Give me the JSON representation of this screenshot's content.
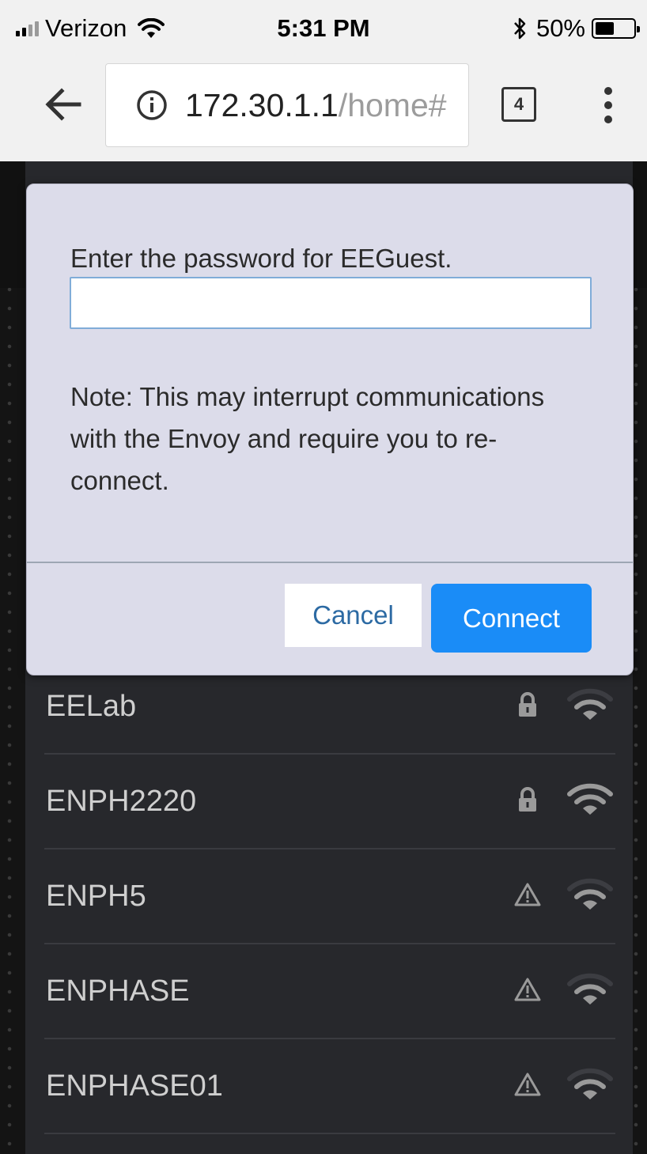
{
  "status_bar": {
    "carrier": "Verizon",
    "time": "5:31 PM",
    "battery": "50%",
    "battery_level": 0.5,
    "icons": [
      "signal-icon",
      "wifi-icon",
      "bluetooth-icon",
      "battery-icon"
    ]
  },
  "browser": {
    "url_host": "172.30.1.1",
    "url_path": "/home#",
    "tab_count": "4",
    "icons": [
      "back-arrow-icon",
      "info-icon",
      "tabs-icon",
      "more-vert-icon"
    ]
  },
  "dialog": {
    "prompt": "Enter the password for EEGuest.",
    "password_value": "",
    "note": "Note: This may interrupt communications with the Envoy and require you to re-connect.",
    "cancel_label": "Cancel",
    "connect_label": "Connect"
  },
  "networks": [
    {
      "name": "EELab",
      "status_icon": "lock-icon"
    },
    {
      "name": "ENPH2220",
      "status_icon": "lock-icon"
    },
    {
      "name": "ENPH5",
      "status_icon": "warning-icon"
    },
    {
      "name": "ENPHASE",
      "status_icon": "warning-icon"
    },
    {
      "name": "ENPHASE01",
      "status_icon": "warning-icon"
    }
  ],
  "colors": {
    "dialog_bg": "#dcdcea",
    "connect_button": "#1a8cf7",
    "panel_bg": "#27282c"
  }
}
